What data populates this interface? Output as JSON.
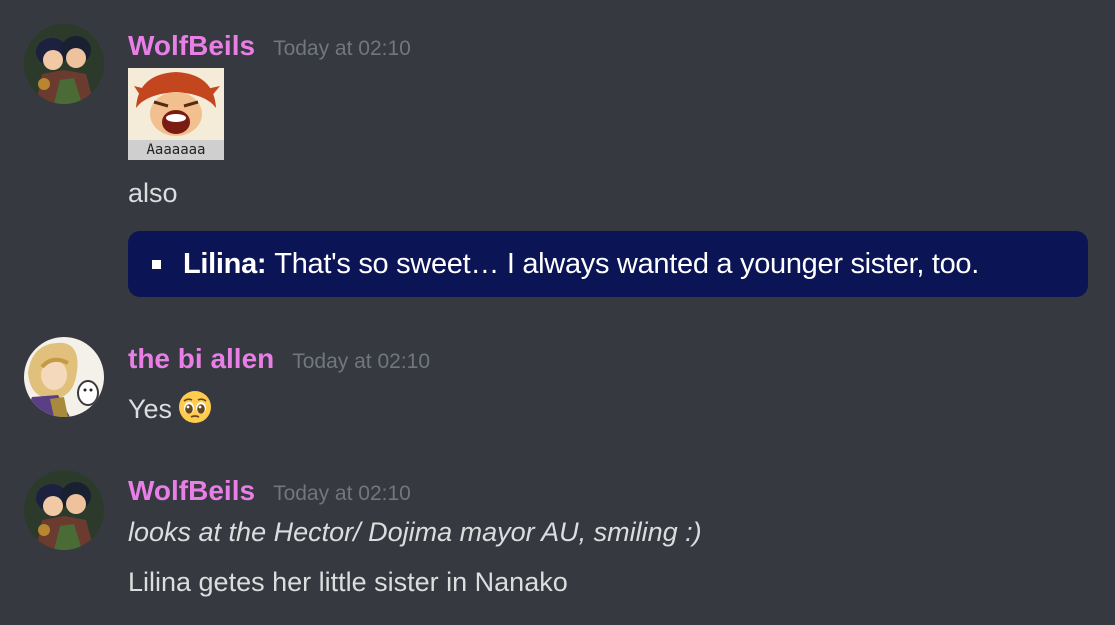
{
  "messages": [
    {
      "author": "WolfBeils",
      "timestamp": "Today at 02:10",
      "sticker": {
        "caption": "Aaaaaaa"
      },
      "text": "also",
      "quote": {
        "speaker": "Lilina:",
        "line": "That's so sweet… I always wanted a younger sister, too."
      }
    },
    {
      "author": "the bi allen",
      "timestamp": "Today at 02:10",
      "text": "Yes",
      "emoji": "pleading-face"
    },
    {
      "author": "WolfBeils",
      "timestamp": "Today at 02:10",
      "lines": [
        "looks at the Hector/ Dojima mayor AU, smiling :)",
        "Lilina getes her little sister in Nanako"
      ]
    }
  ],
  "colors": {
    "background": "#36393f",
    "username": "#e87ee6",
    "timestamp": "#72767d",
    "text": "#dcddde",
    "quote_background": "#0b1455"
  }
}
